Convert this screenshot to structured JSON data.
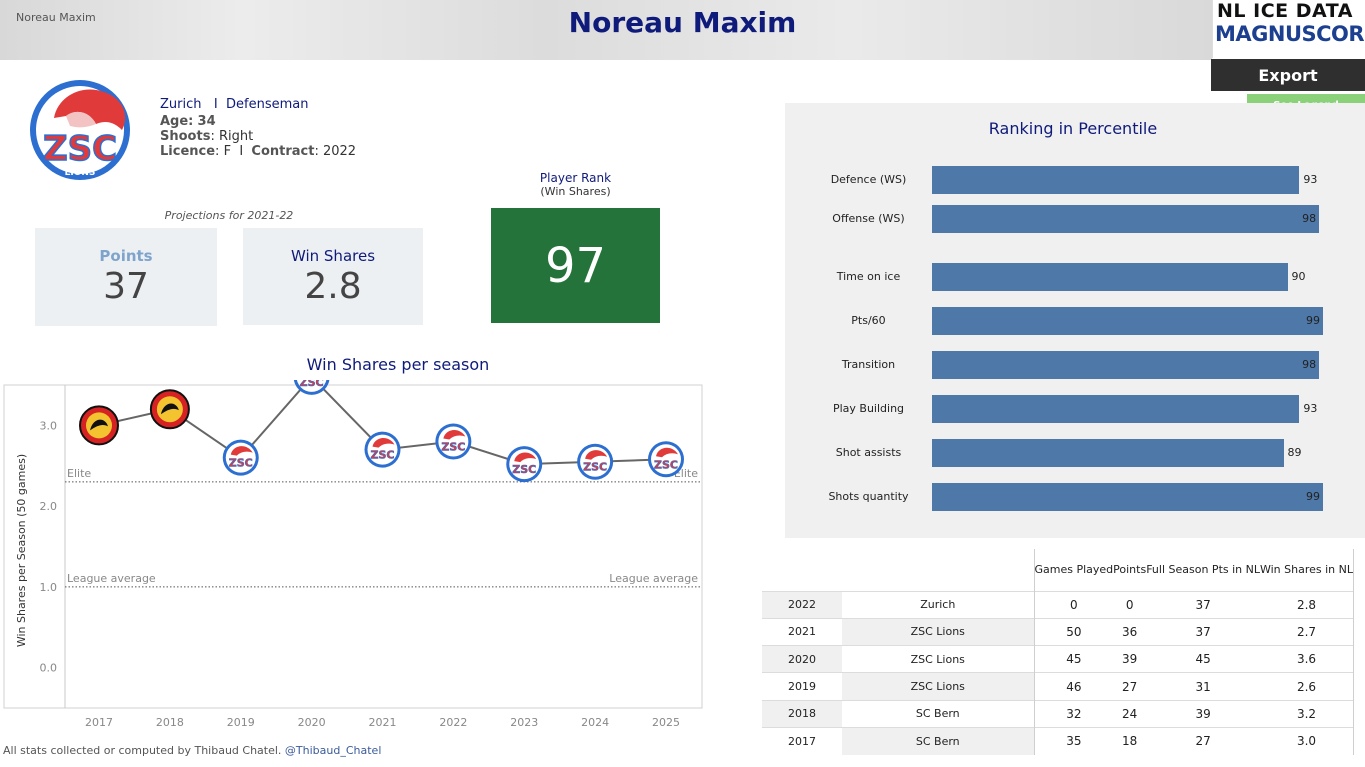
{
  "header": {
    "name_small": "Noreau Maxim",
    "title": "Noreau Maxim",
    "brand_line1": "NL ICE DATA",
    "brand_line2": "MAGNUSCORSI",
    "export_label": "Export",
    "legend_label": "See Legend"
  },
  "player": {
    "team": "Zurich",
    "separator": "I",
    "position": "Defenseman",
    "age_label": "Age:",
    "age": "34",
    "shoots_label": "Shoots",
    "shoots": "Right",
    "licence_label": "Licence",
    "licence": "F",
    "contract_label": "Contract",
    "contract": "2022",
    "logo": "zsc-lions-logo"
  },
  "projections": {
    "caption": "Projections for 2021-22",
    "points_label": "Points",
    "points_value": "37",
    "ws_label": "Win Shares",
    "ws_value": "2.8",
    "points_label_color": "#7fa4cc",
    "ws_label_color": "#0f1b7a"
  },
  "rank": {
    "title": "Player Rank",
    "subtitle": "(Win Shares)",
    "value": "97",
    "color": "#24733a"
  },
  "chart_data": [
    {
      "type": "line",
      "title": "Win Shares per season",
      "ylabel": "Win Shares per Season (50 games)",
      "xlabel": "",
      "ylim": [
        -0.5,
        3.5
      ],
      "yticks": [
        "0.0",
        "1.0",
        "2.0",
        "3.0"
      ],
      "categories": [
        "2017",
        "2018",
        "2019",
        "2020",
        "2021",
        "2022",
        "2023",
        "2024",
        "2025"
      ],
      "series": [
        {
          "values": [
            3.0,
            3.2,
            2.6,
            3.6,
            2.7,
            2.8,
            2.52,
            2.55,
            2.58
          ],
          "team_logos": [
            "sc-bern-logo",
            "sc-bern-logo",
            "zsc-lions-logo",
            "zsc-lions-logo",
            "zsc-lions-logo",
            "zsc-lions-logo",
            "zsc-lions-logo",
            "zsc-lions-logo",
            "zsc-lions-logo"
          ]
        }
      ],
      "reference_lines": [
        {
          "label": "Elite",
          "value": 2.3
        },
        {
          "label": "League average",
          "value": 1.0
        }
      ],
      "line_color": "#666666"
    },
    {
      "type": "bar",
      "title": "Ranking in Percentile",
      "categories": [
        "Defence (WS)",
        "Offense (WS)",
        "Time on ice",
        "Pts/60",
        "Transition",
        "Play Building",
        "Shot assists",
        "Shots quantity"
      ],
      "values": [
        93,
        98,
        90,
        99,
        98,
        93,
        89,
        99
      ],
      "xlim": [
        0,
        100
      ],
      "bar_color": "#4e78a8"
    }
  ],
  "table": {
    "headers": [
      "",
      "",
      "Games Played",
      "Points",
      "Full Season Pts in NL",
      "Win Shares in NL"
    ],
    "rows": [
      [
        "2022",
        "Zurich",
        "0",
        "0",
        "37",
        "2.8"
      ],
      [
        "2021",
        "ZSC Lions",
        "50",
        "36",
        "37",
        "2.7"
      ],
      [
        "2020",
        "ZSC Lions",
        "45",
        "39",
        "45",
        "3.6"
      ],
      [
        "2019",
        "ZSC Lions",
        "46",
        "27",
        "31",
        "2.6"
      ],
      [
        "2018",
        "SC Bern",
        "32",
        "24",
        "39",
        "3.2"
      ],
      [
        "2017",
        "SC Bern",
        "35",
        "18",
        "27",
        "3.0"
      ]
    ]
  },
  "footer": {
    "text": "All stats collected or computed by Thibaud Chatel.",
    "handle": "@Thibaud_Chatel"
  }
}
